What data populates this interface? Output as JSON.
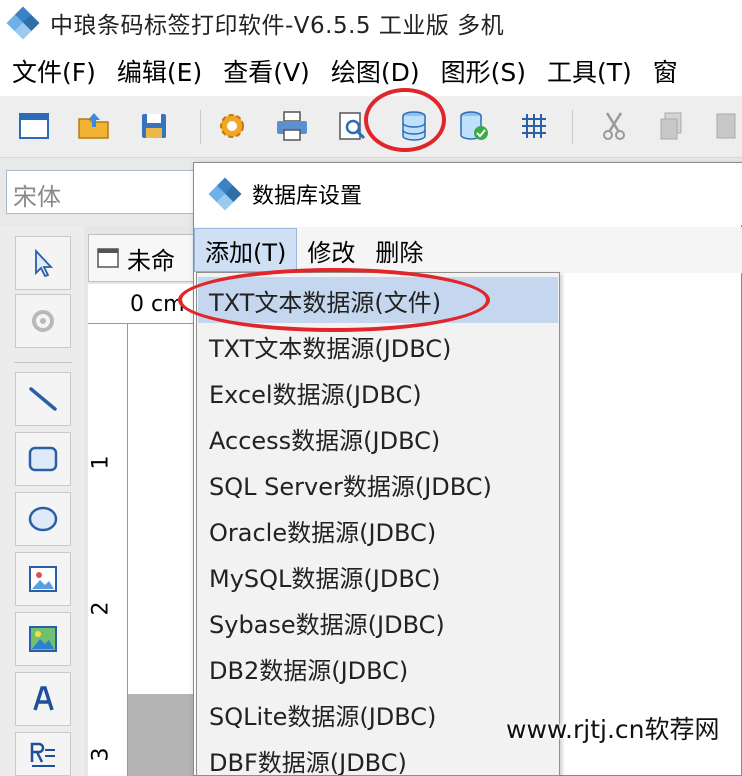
{
  "window": {
    "title": "中琅条码标签打印软件-V6.5.5 工业版 多机"
  },
  "menubar": {
    "items": [
      "文件(F)",
      "编辑(E)",
      "查看(V)",
      "绘图(D)",
      "图形(S)",
      "工具(T)",
      "窗"
    ]
  },
  "toolbar": {
    "icons": [
      "new-window-icon",
      "open-folder-icon",
      "save-icon",
      "settings-gear-icon",
      "print-icon",
      "print-preview-icon",
      "database-icon",
      "database-check-icon",
      "grid-icon",
      "cut-icon",
      "copy-icon",
      "paste-icon"
    ],
    "highlight_color": "#e0262a"
  },
  "fontbar": {
    "font_name": "宋体"
  },
  "document": {
    "tab_label": "未命",
    "ruler_top_label": "0 cm",
    "ruler_left_numbers": [
      "1",
      "2",
      "3"
    ]
  },
  "dialog": {
    "title": "数据库设置",
    "menu": [
      "添加(T)",
      "修改",
      "删除"
    ]
  },
  "dropdown": {
    "items": [
      "TXT文本数据源(文件)",
      "TXT文本数据源(JDBC)",
      "Excel数据源(JDBC)",
      "Access数据源(JDBC)",
      "SQL Server数据源(JDBC)",
      "Oracle数据源(JDBC)",
      "MySQL数据源(JDBC)",
      "Sybase数据源(JDBC)",
      "DB2数据源(JDBC)",
      "SQLite数据源(JDBC)",
      "DBF数据源(JDBC)"
    ],
    "selected_index": 0,
    "selected_color": "#c5d7ef"
  },
  "watermark": {
    "text": "www.rjtj.cn软荐网"
  }
}
